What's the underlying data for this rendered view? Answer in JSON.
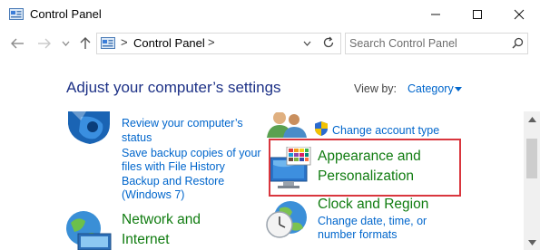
{
  "window": {
    "title": "Control Panel"
  },
  "address_bar": {
    "crumb": "Control Panel",
    "separator": ">"
  },
  "search": {
    "placeholder": "Search Control Panel"
  },
  "main": {
    "heading": "Adjust your computer’s settings",
    "view_by_label": "View by:",
    "view_by_value": "Category"
  },
  "left_column": {
    "system_security": {
      "links": [
        "Review your computer’s",
        "status",
        "Save backup copies of your",
        "files with File History",
        "Backup and Restore",
        "(Windows 7)"
      ]
    },
    "network": {
      "title_line1": "Network and",
      "title_line2": "Internet"
    }
  },
  "right_column": {
    "user_accounts": {
      "link": "Change account type"
    },
    "appearance": {
      "title_line1": "Appearance and",
      "title_line2": "Personalization"
    },
    "clock_region": {
      "title": "Clock and Region",
      "links": [
        "Change date, time, or",
        "number formats"
      ]
    }
  },
  "icons": {
    "app": "control-panel-icon",
    "back": "back-arrow-icon",
    "forward": "forward-arrow-icon",
    "recent": "chevron-down-icon",
    "up": "up-arrow-icon",
    "refresh": "refresh-icon",
    "search": "search-icon",
    "shield": "uac-shield-icon"
  },
  "colors": {
    "link": "#0066cc",
    "category_title": "#107c10",
    "heading": "#1e3287",
    "highlight": "#d9363e"
  }
}
